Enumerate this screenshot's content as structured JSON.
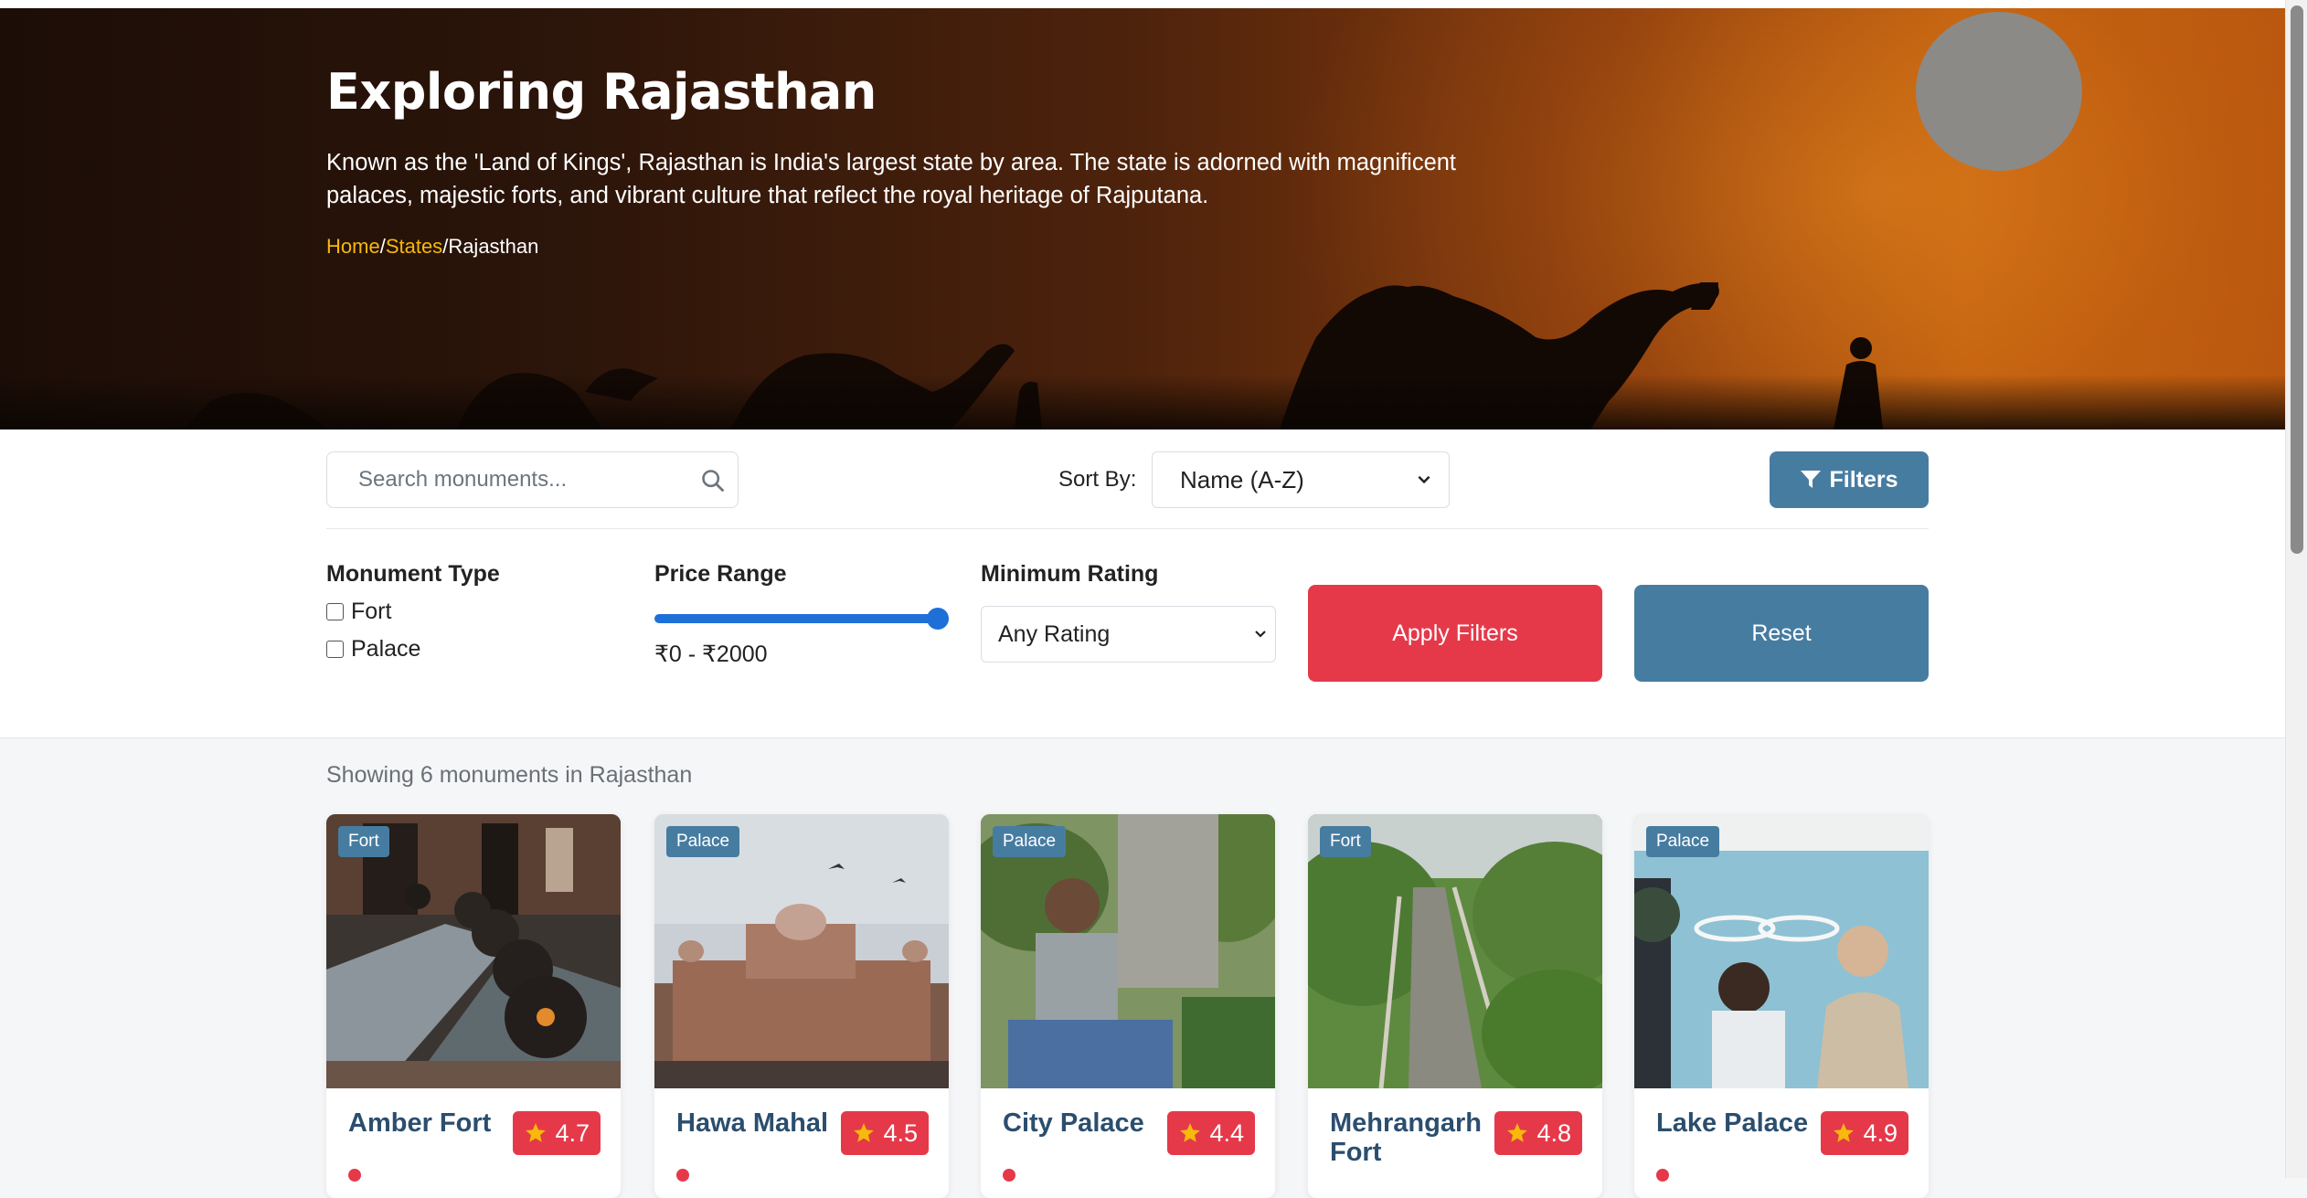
{
  "hero": {
    "title": "Exploring Rajasthan",
    "description": "Known as the 'Land of Kings', Rajasthan is India's largest state by area. The state is adorned with magnificent palaces, majestic forts, and vibrant culture that reflect the royal heritage of Rajputana.",
    "breadcrumb": {
      "home": "Home",
      "sep": "/",
      "states": "States",
      "current": "Rajasthan"
    }
  },
  "toolbar": {
    "search_placeholder": "Search monuments...",
    "sort_label": "Sort By:",
    "sort_value": "Name (A-Z)",
    "filters_label": "Filters"
  },
  "filters": {
    "type_title": "Monument Type",
    "types": [
      "Fort",
      "Palace"
    ],
    "price_title": "Price Range",
    "price_text": "₹0 - ₹2000",
    "price_slider_value": 1.0,
    "rating_title": "Minimum Rating",
    "rating_value": "Any Rating",
    "apply_label": "Apply Filters",
    "reset_label": "Reset"
  },
  "results": {
    "count_text": "Showing 6 monuments in Rajasthan"
  },
  "cards": [
    {
      "tag": "Fort",
      "name": "Amber Fort",
      "rating": "4.7"
    },
    {
      "tag": "Palace",
      "name": "Hawa Mahal",
      "rating": "4.5"
    },
    {
      "tag": "Palace",
      "name": "City Palace",
      "rating": "4.4"
    },
    {
      "tag": "Fort",
      "name": "Mehrangarh Fort",
      "rating": "4.8"
    },
    {
      "tag": "Palace",
      "name": "Lake Palace",
      "rating": "4.9"
    }
  ],
  "colors": {
    "accent_blue": "#477ca1",
    "accent_red": "#e5394a",
    "breadcrumb_link": "#f6b90c",
    "card_title": "#2b4e6e"
  }
}
